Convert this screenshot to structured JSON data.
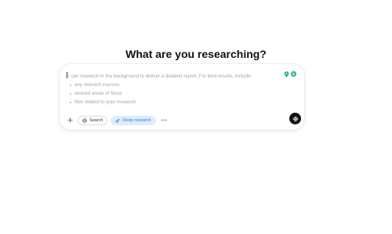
{
  "heading": "What are you researching?",
  "composer": {
    "placeholder_intro": "I can research in the background to deliver a detailed report. For best results, include:",
    "placeholder_bullets": [
      "any relevant sources",
      "desired areas of focus",
      "files related to your research"
    ],
    "extension_icons": [
      "location-pin-icon",
      "grammarly-icon"
    ]
  },
  "toolbar": {
    "add_icon": "plus-icon",
    "search_label": "Search",
    "search_icon": "globe-icon",
    "deep_research_label": "Deep research",
    "deep_research_icon": "telescope-icon",
    "more_icon": "ellipsis-icon",
    "voice_icon": "voice-waveform-icon"
  },
  "colors": {
    "accent_chip_bg": "#dcecfb",
    "accent_chip_text": "#2f7fd6",
    "voice_button_bg": "#111111",
    "extension_green": "#15a884"
  }
}
